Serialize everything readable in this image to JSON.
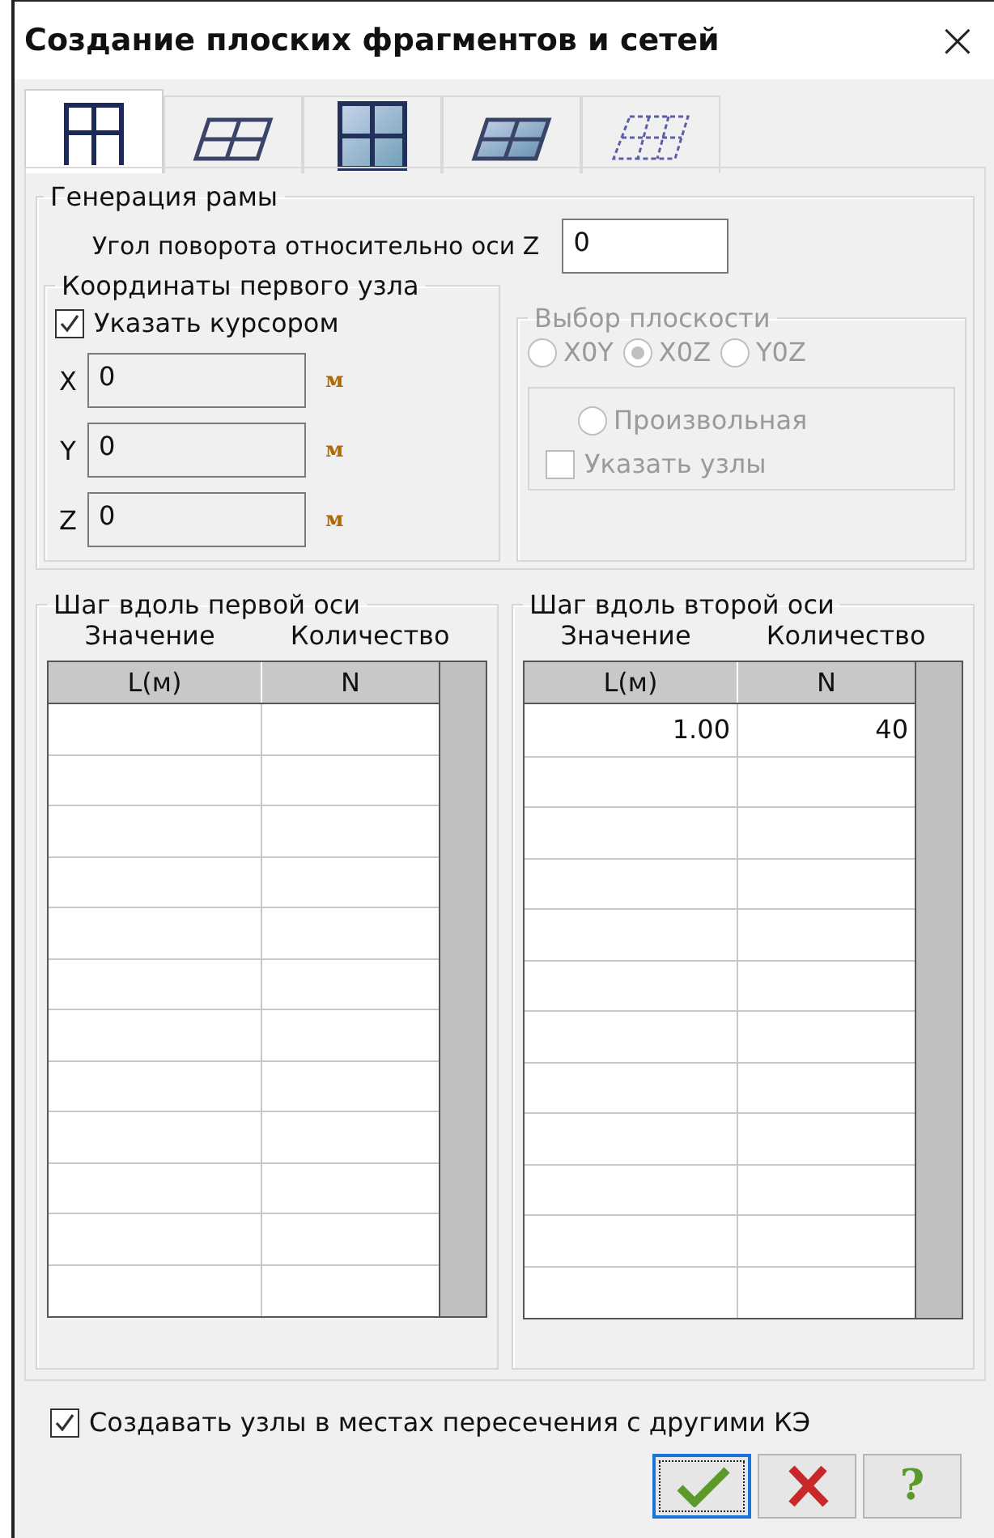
{
  "window": {
    "title": "Создание плоских фрагментов и сетей",
    "close": "×"
  },
  "tabs": [
    {
      "kind": "frame",
      "selected": true
    },
    {
      "kind": "grid-flat",
      "selected": false
    },
    {
      "kind": "plate",
      "selected": false
    },
    {
      "kind": "plate-flat",
      "selected": false
    },
    {
      "kind": "dashed",
      "selected": false
    }
  ],
  "generation": {
    "title": "Генерация  рамы",
    "angle_label": "Угол поворота относительно оси Z",
    "angle_value": "0"
  },
  "coords": {
    "title": "Координаты первого узла",
    "cursor_label": "Указать курсором",
    "cursor_checked": true,
    "fields": [
      {
        "axis": "X",
        "value": "0",
        "unit": "м"
      },
      {
        "axis": "Y",
        "value": "0",
        "unit": "м"
      },
      {
        "axis": "Z",
        "value": "0",
        "unit": "м"
      }
    ]
  },
  "plane": {
    "title": "Выбор плоскости",
    "disabled": true,
    "options": [
      {
        "label": "X0Y",
        "selected": false
      },
      {
        "label": "X0Z",
        "selected": true
      },
      {
        "label": "Y0Z",
        "selected": false
      }
    ],
    "arbitrary": {
      "label": "Произвольная",
      "selected": false
    },
    "nodes": {
      "label": "Указать узлы",
      "checked": false
    }
  },
  "steps": [
    {
      "title": "Шаг вдоль первой оси",
      "value_label": "Значение",
      "count_label": "Количество",
      "columns": [
        "L(м)",
        "N"
      ]
    },
    {
      "title": "Шаг вдоль второй оси",
      "value_label": "Значение",
      "count_label": "Количество",
      "columns": [
        "L(м)",
        "N"
      ],
      "rows": [
        [
          "1.00",
          "40"
        ]
      ]
    }
  ],
  "intersect": {
    "label": "Создавать узлы в местах пересечения с другими КЭ",
    "checked": true
  },
  "buttons": [
    {
      "kind": "ok",
      "focused": true
    },
    {
      "kind": "cancel",
      "focused": false
    },
    {
      "kind": "help",
      "label": "?",
      "focused": false
    }
  ]
}
